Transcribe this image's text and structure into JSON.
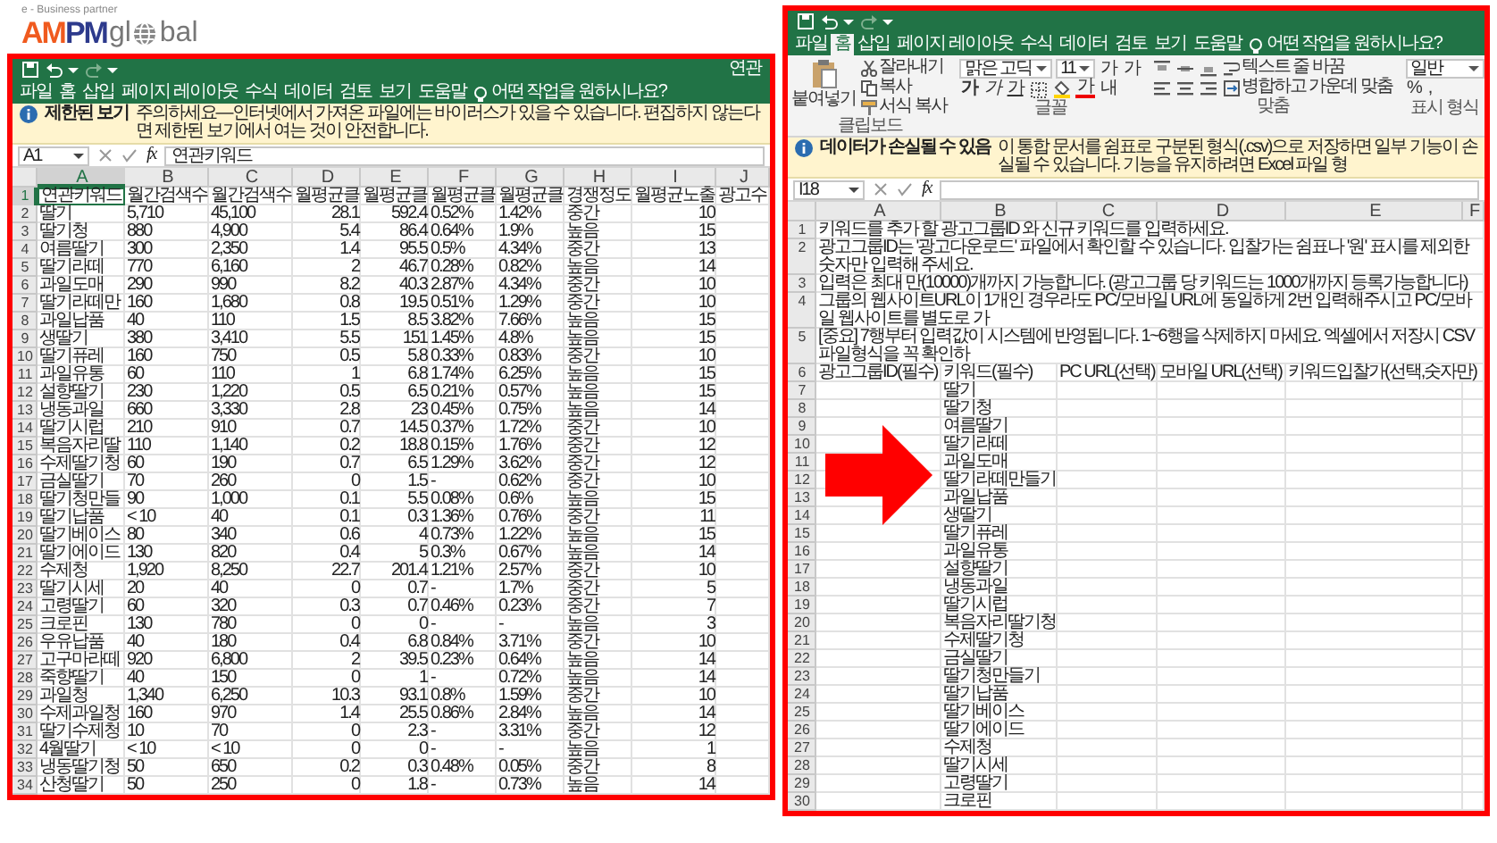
{
  "logo": {
    "tagline": "e - Business partner",
    "brand": "AMPM",
    "word_start": "gl",
    "word_end": "bal"
  },
  "left_window": {
    "title": "연관",
    "tabs": [
      {
        "label": "파일",
        "selected": false
      },
      {
        "label": "홈",
        "selected": false
      },
      {
        "label": "삽입",
        "selected": false
      },
      {
        "label": "페이지 레이아웃",
        "selected": false
      },
      {
        "label": "수식",
        "selected": false
      },
      {
        "label": "데이터",
        "selected": false
      },
      {
        "label": "검토",
        "selected": false
      },
      {
        "label": "보기",
        "selected": false
      },
      {
        "label": "도움말",
        "selected": false
      }
    ],
    "tell_me": "어떤 작업을 원하시나요?",
    "notice": {
      "title": "제한된 보기",
      "message": "주의하세요—인터넷에서 가져온 파일에는 바이러스가 있을 수 있습니다. 편집하지 않는다면 제한된 보기에서 여는 것이 안전합니다."
    },
    "name_box": "A1",
    "function_label": "fx",
    "formula": "연관키워드",
    "columns": [
      {
        "letter": "A",
        "kind": "text",
        "selected": true
      },
      {
        "letter": "B",
        "kind": "text",
        "selected": false
      },
      {
        "letter": "C",
        "kind": "text",
        "selected": false
      },
      {
        "letter": "D",
        "kind": "number",
        "selected": false
      },
      {
        "letter": "E",
        "kind": "number",
        "selected": false
      },
      {
        "letter": "F",
        "kind": "text",
        "selected": false
      },
      {
        "letter": "G",
        "kind": "text",
        "selected": false
      },
      {
        "letter": "H",
        "kind": "text",
        "selected": false
      },
      {
        "letter": "I",
        "kind": "number",
        "selected": false
      },
      {
        "letter": "J",
        "kind": "text",
        "selected": false
      }
    ],
    "rows": [
      {
        "number": "1",
        "kind": "header",
        "selected": true,
        "cells": [
          "연관키워드",
          "월간검색수",
          "월간검색수",
          "월평균클",
          "월평균클",
          "월평균클",
          "월평균클",
          "경쟁정도",
          "월평균노출",
          "광고수"
        ]
      },
      {
        "number": "2",
        "kind": "data",
        "selected": false,
        "cells": [
          "딸기",
          "5,710",
          "45,100",
          "28.1",
          "592.4",
          "0.52%",
          "1.42%",
          "중간",
          "10"
        ]
      },
      {
        "number": "3",
        "kind": "data",
        "selected": false,
        "cells": [
          "딸기청",
          "880",
          "4,900",
          "5.4",
          "86.4",
          "0.64%",
          "1.9%",
          "높음",
          "15"
        ]
      },
      {
        "number": "4",
        "kind": "data",
        "selected": false,
        "cells": [
          "여름딸기",
          "300",
          "2,350",
          "1.4",
          "95.5",
          "0.5%",
          "4.34%",
          "중간",
          "13"
        ]
      },
      {
        "number": "5",
        "kind": "data",
        "selected": false,
        "cells": [
          "딸기라떼",
          "770",
          "6,160",
          "2",
          "46.7",
          "0.28%",
          "0.82%",
          "높음",
          "14"
        ]
      },
      {
        "number": "6",
        "kind": "data",
        "selected": false,
        "cells": [
          "과일도매",
          "290",
          "990",
          "8.2",
          "40.3",
          "2.87%",
          "4.34%",
          "중간",
          "10"
        ]
      },
      {
        "number": "7",
        "kind": "data",
        "selected": false,
        "cells": [
          "딸기라떼만",
          "160",
          "1,680",
          "0.8",
          "19.5",
          "0.51%",
          "1.29%",
          "중간",
          "10"
        ]
      },
      {
        "number": "8",
        "kind": "data",
        "selected": false,
        "cells": [
          "과일납품",
          "40",
          "110",
          "1.5",
          "8.5",
          "3.82%",
          "7.66%",
          "높음",
          "15"
        ]
      },
      {
        "number": "9",
        "kind": "data",
        "selected": false,
        "cells": [
          "생딸기",
          "380",
          "3,410",
          "5.5",
          "151",
          "1.45%",
          "4.8%",
          "높음",
          "15"
        ]
      },
      {
        "number": "10",
        "kind": "data",
        "selected": false,
        "cells": [
          "딸기퓨레",
          "160",
          "750",
          "0.5",
          "5.8",
          "0.33%",
          "0.83%",
          "중간",
          "10"
        ]
      },
      {
        "number": "11",
        "kind": "data",
        "selected": false,
        "cells": [
          "과일유통",
          "60",
          "110",
          "1",
          "6.8",
          "1.74%",
          "6.25%",
          "높음",
          "15"
        ]
      },
      {
        "number": "12",
        "kind": "data",
        "selected": false,
        "cells": [
          "설향딸기",
          "230",
          "1,220",
          "0.5",
          "6.5",
          "0.21%",
          "0.57%",
          "높음",
          "15"
        ]
      },
      {
        "number": "13",
        "kind": "data",
        "selected": false,
        "cells": [
          "냉동과일",
          "660",
          "3,330",
          "2.8",
          "23",
          "0.45%",
          "0.75%",
          "높음",
          "14"
        ]
      },
      {
        "number": "14",
        "kind": "data",
        "selected": false,
        "cells": [
          "딸기시럽",
          "210",
          "910",
          "0.7",
          "14.5",
          "0.37%",
          "1.72%",
          "중간",
          "10"
        ]
      },
      {
        "number": "15",
        "kind": "data",
        "selected": false,
        "cells": [
          "복음자리딸",
          "110",
          "1,140",
          "0.2",
          "18.8",
          "0.15%",
          "1.76%",
          "중간",
          "12"
        ]
      },
      {
        "number": "16",
        "kind": "data",
        "selected": false,
        "cells": [
          "수제딸기청",
          "60",
          "190",
          "0.7",
          "6.5",
          "1.29%",
          "3.62%",
          "중간",
          "12"
        ]
      },
      {
        "number": "17",
        "kind": "data",
        "selected": false,
        "cells": [
          "금실딸기",
          "70",
          "260",
          "0",
          "1.5",
          "-",
          "0.62%",
          "중간",
          "10"
        ]
      },
      {
        "number": "18",
        "kind": "data",
        "selected": false,
        "cells": [
          "딸기청만들",
          "90",
          "1,000",
          "0.1",
          "5.5",
          "0.08%",
          "0.6%",
          "높음",
          "15"
        ]
      },
      {
        "number": "19",
        "kind": "data",
        "selected": false,
        "cells": [
          "딸기납품",
          "< 10",
          "40",
          "0.1",
          "0.3",
          "1.36%",
          "0.76%",
          "중간",
          "11"
        ]
      },
      {
        "number": "20",
        "kind": "data",
        "selected": false,
        "cells": [
          "딸기베이스",
          "80",
          "340",
          "0.6",
          "4",
          "0.73%",
          "1.22%",
          "높음",
          "15"
        ]
      },
      {
        "number": "21",
        "kind": "data",
        "selected": false,
        "cells": [
          "딸기에이드",
          "130",
          "820",
          "0.4",
          "5",
          "0.3%",
          "0.67%",
          "높음",
          "14"
        ]
      },
      {
        "number": "22",
        "kind": "data",
        "selected": false,
        "cells": [
          "수제청",
          "1,920",
          "8,250",
          "22.7",
          "201.4",
          "1.21%",
          "2.57%",
          "중간",
          "10"
        ]
      },
      {
        "number": "23",
        "kind": "data",
        "selected": false,
        "cells": [
          "딸기시세",
          "20",
          "40",
          "0",
          "0.7",
          "-",
          "1.7%",
          "중간",
          "5"
        ]
      },
      {
        "number": "24",
        "kind": "data",
        "selected": false,
        "cells": [
          "고령딸기",
          "60",
          "320",
          "0.3",
          "0.7",
          "0.46%",
          "0.23%",
          "중간",
          "7"
        ]
      },
      {
        "number": "25",
        "kind": "data",
        "selected": false,
        "cells": [
          "크로핀",
          "130",
          "780",
          "0",
          "0",
          "-",
          "-",
          "높음",
          "3"
        ]
      },
      {
        "number": "26",
        "kind": "data",
        "selected": false,
        "cells": [
          "우유납품",
          "40",
          "180",
          "0.4",
          "6.8",
          "0.84%",
          "3.71%",
          "중간",
          "10"
        ]
      },
      {
        "number": "27",
        "kind": "data",
        "selected": false,
        "cells": [
          "고구마라떼",
          "920",
          "6,800",
          "2",
          "39.5",
          "0.23%",
          "0.64%",
          "높음",
          "14"
        ]
      },
      {
        "number": "28",
        "kind": "data",
        "selected": false,
        "cells": [
          "죽향딸기",
          "40",
          "150",
          "0",
          "1",
          "-",
          "0.72%",
          "높음",
          "14"
        ]
      },
      {
        "number": "29",
        "kind": "data",
        "selected": false,
        "cells": [
          "과일청",
          "1,340",
          "6,250",
          "10.3",
          "93.1",
          "0.8%",
          "1.59%",
          "중간",
          "10"
        ]
      },
      {
        "number": "30",
        "kind": "data",
        "selected": false,
        "cells": [
          "수제과일청",
          "160",
          "970",
          "1.4",
          "25.5",
          "0.86%",
          "2.84%",
          "높음",
          "14"
        ]
      },
      {
        "number": "31",
        "kind": "data",
        "selected": false,
        "cells": [
          "딸기수제청",
          "10",
          "70",
          "0",
          "2.3",
          "-",
          "3.31%",
          "중간",
          "12"
        ]
      },
      {
        "number": "32",
        "kind": "data",
        "selected": false,
        "cells": [
          "4월딸기",
          "< 10",
          "< 10",
          "0",
          "0",
          "-",
          "-",
          "높음",
          "1"
        ]
      },
      {
        "number": "33",
        "kind": "data",
        "selected": false,
        "cells": [
          "냉동딸기청",
          "50",
          "650",
          "0.2",
          "0.3",
          "0.48%",
          "0.05%",
          "중간",
          "8"
        ]
      },
      {
        "number": "34",
        "kind": "data",
        "selected": false,
        "cells": [
          "산청딸기",
          "50",
          "250",
          "0",
          "1.8",
          "-",
          "0.73%",
          "높음",
          "14"
        ]
      }
    ]
  },
  "right_window": {
    "tabs": [
      {
        "label": "파일",
        "selected": false
      },
      {
        "label": "홈",
        "selected": true
      },
      {
        "label": "삽입",
        "selected": false
      },
      {
        "label": "페이지 레이아웃",
        "selected": false
      },
      {
        "label": "수식",
        "selected": false
      },
      {
        "label": "데이터",
        "selected": false
      },
      {
        "label": "검토",
        "selected": false
      },
      {
        "label": "보기",
        "selected": false
      },
      {
        "label": "도움말",
        "selected": false
      }
    ],
    "tell_me": "어떤 작업을 원하시나요?",
    "ribbon": {
      "clipboard": {
        "label": "클립보드",
        "paste": "붙여넣기",
        "cut": "잘라내기",
        "copy": "복사",
        "format_painter": "서식 복사"
      },
      "font": {
        "label": "글꼴",
        "font_name": "맑은 고딕",
        "font_size": "11",
        "grow": "가",
        "shrink": "가",
        "bold": "가",
        "italic": "가",
        "underline": "가",
        "font_color": "가",
        "phonetic": "내"
      },
      "alignment": {
        "label": "맞춤",
        "wrap_text": "텍스트 줄 바꿈",
        "merge": "병합하고 가운데 맞춤"
      },
      "number": {
        "label": "표시 형식",
        "format": "일반",
        "percent": "%",
        "comma": ","
      }
    },
    "notice": {
      "title": "데이터가 손실될 수 있음",
      "message": "이 통합 문서를 쉼표로 구분된 형식(.csv)으로 저장하면 일부 기능이 손실될 수 있습니다. 기능을 유지하려면 Excel 파일 형"
    },
    "name_box": "I18",
    "function_label": "fx",
    "columns": [
      {
        "letter": "A",
        "kind": "text",
        "selected": false
      },
      {
        "letter": "B",
        "kind": "text",
        "selected": false
      },
      {
        "letter": "C",
        "kind": "text",
        "selected": false
      },
      {
        "letter": "D",
        "kind": "text",
        "selected": false
      },
      {
        "letter": "E",
        "kind": "text",
        "selected": false
      },
      {
        "letter": "F",
        "kind": "text",
        "selected": false
      }
    ],
    "rows": [
      {
        "number": "1",
        "selected": false,
        "cells": [
          "키워드를 추가 할 광고그룹ID 와 신규 키워드를 입력하세요."
        ]
      },
      {
        "number": "2",
        "selected": false,
        "cells": [
          "광고그룹ID는 '광고다운로드' 파일에서 확인할 수 있습니다. 입찰가는 쉼표나 '원' 표시를 제외한 숫자만 입력해 주세요."
        ]
      },
      {
        "number": "3",
        "selected": false,
        "cells": [
          "입력은 최대 만(10000)개까지 가능합니다. (광고그룹 당 키워드는 1000개까지 등록가능합니다)"
        ]
      },
      {
        "number": "4",
        "selected": false,
        "cells": [
          "그룹의 웹사이트URL이 1개인 경우라도 PC/모바일 URL에 동일하게 2번 입력해주시고 PC/모바일 웹사이트를 별도로 가"
        ]
      },
      {
        "number": "5",
        "selected": false,
        "cells": [
          "[중요] 7행부터 입력값이 시스템에 반영됩니다. 1~6행을 삭제하지 마세요. 엑셀에서 저장시 CSV 파일형식을 꼭 확인하"
        ]
      },
      {
        "number": "6",
        "selected": false,
        "cells": [
          "광고그룹ID(필수)",
          "키워드(필수)",
          "PC URL(선택)",
          "모바일 URL(선택)",
          "키워드입찰가(선택,숫자만)"
        ]
      },
      {
        "number": "7",
        "selected": false,
        "cells": [
          null,
          "딸기"
        ]
      },
      {
        "number": "8",
        "selected": false,
        "cells": [
          null,
          "딸기청"
        ]
      },
      {
        "number": "9",
        "selected": false,
        "cells": [
          null,
          "여름딸기"
        ]
      },
      {
        "number": "10",
        "selected": false,
        "cells": [
          null,
          "딸기라떼"
        ]
      },
      {
        "number": "11",
        "selected": false,
        "cells": [
          null,
          "과일도매"
        ]
      },
      {
        "number": "12",
        "selected": false,
        "cells": [
          null,
          "딸기라떼만들기"
        ]
      },
      {
        "number": "13",
        "selected": false,
        "cells": [
          null,
          "과일납품"
        ]
      },
      {
        "number": "14",
        "selected": false,
        "cells": [
          null,
          "생딸기"
        ]
      },
      {
        "number": "15",
        "selected": false,
        "cells": [
          null,
          "딸기퓨레"
        ]
      },
      {
        "number": "16",
        "selected": false,
        "cells": [
          null,
          "과일유통"
        ]
      },
      {
        "number": "17",
        "selected": false,
        "cells": [
          null,
          "설향딸기"
        ]
      },
      {
        "number": "18",
        "selected": false,
        "cells": [
          null,
          "냉동과일"
        ]
      },
      {
        "number": "19",
        "selected": false,
        "cells": [
          null,
          "딸기시럽"
        ]
      },
      {
        "number": "20",
        "selected": false,
        "cells": [
          null,
          "복음자리딸기청"
        ]
      },
      {
        "number": "21",
        "selected": false,
        "cells": [
          null,
          "수제딸기청"
        ]
      },
      {
        "number": "22",
        "selected": false,
        "cells": [
          null,
          "금실딸기"
        ]
      },
      {
        "number": "23",
        "selected": false,
        "cells": [
          null,
          "딸기청만들기"
        ]
      },
      {
        "number": "24",
        "selected": false,
        "cells": [
          null,
          "딸기납품"
        ]
      },
      {
        "number": "25",
        "selected": false,
        "cells": [
          null,
          "딸기베이스"
        ]
      },
      {
        "number": "26",
        "selected": false,
        "cells": [
          null,
          "딸기에이드"
        ]
      },
      {
        "number": "27",
        "selected": false,
        "cells": [
          null,
          "수제청"
        ]
      },
      {
        "number": "28",
        "selected": false,
        "cells": [
          null,
          "딸기시세"
        ]
      },
      {
        "number": "29",
        "selected": false,
        "cells": [
          null,
          "고령딸기"
        ]
      },
      {
        "number": "30",
        "selected": false,
        "cells": [
          null,
          "크로핀"
        ]
      }
    ]
  }
}
